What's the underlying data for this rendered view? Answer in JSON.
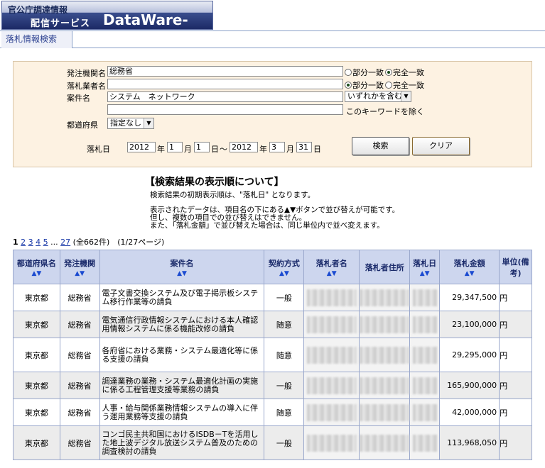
{
  "header": {
    "logo_line1": "官公庁調達情報",
    "logo_line2": "配信サービス",
    "logo_brand": "DataWare-Net"
  },
  "tab": {
    "label": "落札情報検索"
  },
  "form": {
    "agency_label": "発注機関名",
    "agency_value": "総務省",
    "bidder_label": "落札業者名",
    "bidder_value": "",
    "match_partial": "部分一致",
    "match_exact": "完全一致",
    "agency_match_selected": "exact",
    "bidder_match_selected": "partial",
    "case_label": "案件名",
    "case_value": "システム　ネットワーク",
    "case_mode": "いずれかを含む",
    "exclude_value": "",
    "exclude_label": "このキーワードを除く",
    "pref_label": "都道府県",
    "pref_value": "指定なし",
    "date_label": "落札日",
    "from_year": "2012",
    "from_month": "1",
    "from_day": "1",
    "to_year": "2012",
    "to_month": "3",
    "to_day": "31",
    "year_unit": "年",
    "month_unit": "月",
    "day_unit": "日",
    "tilde": "～",
    "search_button": "検索",
    "clear_button": "クリア"
  },
  "notice": {
    "title": "【検索結果の表示順について】",
    "line1": "検索結果の初期表示順は、\"落札日\" となります。",
    "line2": "表示されたデータは、項目名の下にある▲▼ボタンで並び替えが可能です。",
    "line3": "但し、複数の項目での並び替えはできません。",
    "line4": "また、「落札金額」で並び替えた場合は、同じ単位内で並べ変えます。"
  },
  "pager": {
    "current": "1",
    "pages": [
      "2",
      "3",
      "4",
      "5"
    ],
    "ellipsis": "...",
    "last": "27",
    "summary": "(全662件)　(1/27ページ)"
  },
  "table": {
    "headers": [
      "都道府県名",
      "発注機関",
      "案件名",
      "契約方式",
      "落札者名",
      "落札者住所",
      "落札日",
      "落札金額",
      "単位(備考)"
    ],
    "sort_arrows": "▲▼",
    "rows": [
      {
        "pref": "東京都",
        "agency": "総務省",
        "case": "電子文書交換システム及び電子掲示板システム移行作業等の請負",
        "method": "一般",
        "amount": "29,347,500",
        "unit": "円"
      },
      {
        "pref": "東京都",
        "agency": "総務省",
        "case": "電気通信行政情報システムにおける本人確認用情報システムに係る機能改修の請負",
        "method": "随意",
        "amount": "23,100,000",
        "unit": "円"
      },
      {
        "pref": "東京都",
        "agency": "総務省",
        "case": "各府省における業務・システム最適化等に係る支援の請負",
        "method": "随意",
        "amount": "29,295,000",
        "unit": "円"
      },
      {
        "pref": "東京都",
        "agency": "総務省",
        "case": "調達業務の業務・システム最適化計画の実施に係る工程管理支援等業務の請負",
        "method": "一般",
        "amount": "165,900,000",
        "unit": "円"
      },
      {
        "pref": "東京都",
        "agency": "総務省",
        "case": "人事・給与関係業務情報システムの導入に伴う運用業務等支援の請負",
        "method": "随意",
        "amount": "42,000,000",
        "unit": "円"
      },
      {
        "pref": "東京都",
        "agency": "総務省",
        "case": "コンゴ民主共和国におけるISDB－Tを活用した地上波デジタル放送システム普及のための調査検討の請負",
        "method": "一般",
        "amount": "113,968,050",
        "unit": "円"
      }
    ]
  }
}
